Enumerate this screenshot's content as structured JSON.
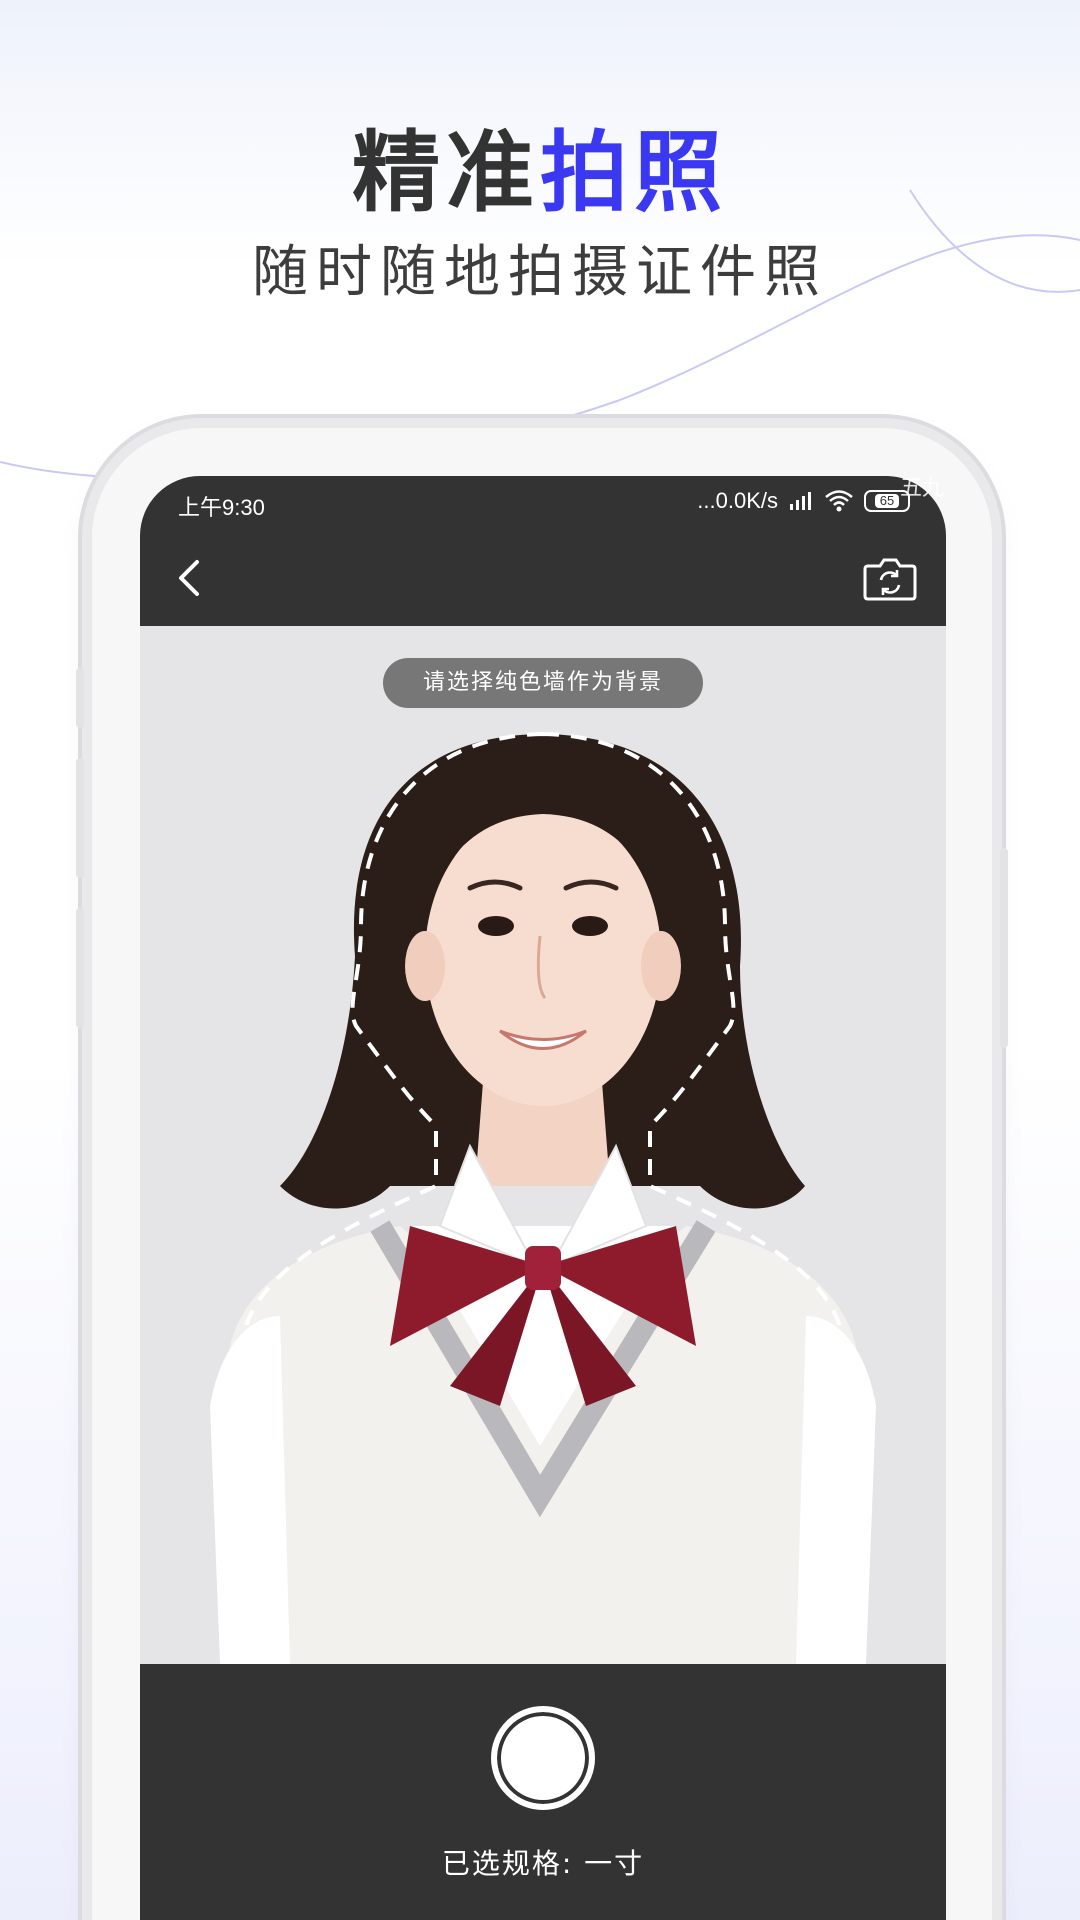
{
  "promo": {
    "headline_plain": "精准",
    "headline_accent": "拍照",
    "subheadline": "随时随地拍摄证件照",
    "accent_color": "#3a38f0"
  },
  "status_bar": {
    "time": "上午9:30",
    "network_speed": "...0.0K/s",
    "battery": "65",
    "icons": [
      "signal-icon",
      "wifi-icon",
      "battery-icon"
    ]
  },
  "nav": {
    "back_icon": "chevron-left-icon",
    "switch_camera_icon": "camera-switch-icon"
  },
  "camera": {
    "hint": "请选择纯色墙作为背景",
    "spec_label": "已选规格: 一寸"
  },
  "watermark": "五九"
}
